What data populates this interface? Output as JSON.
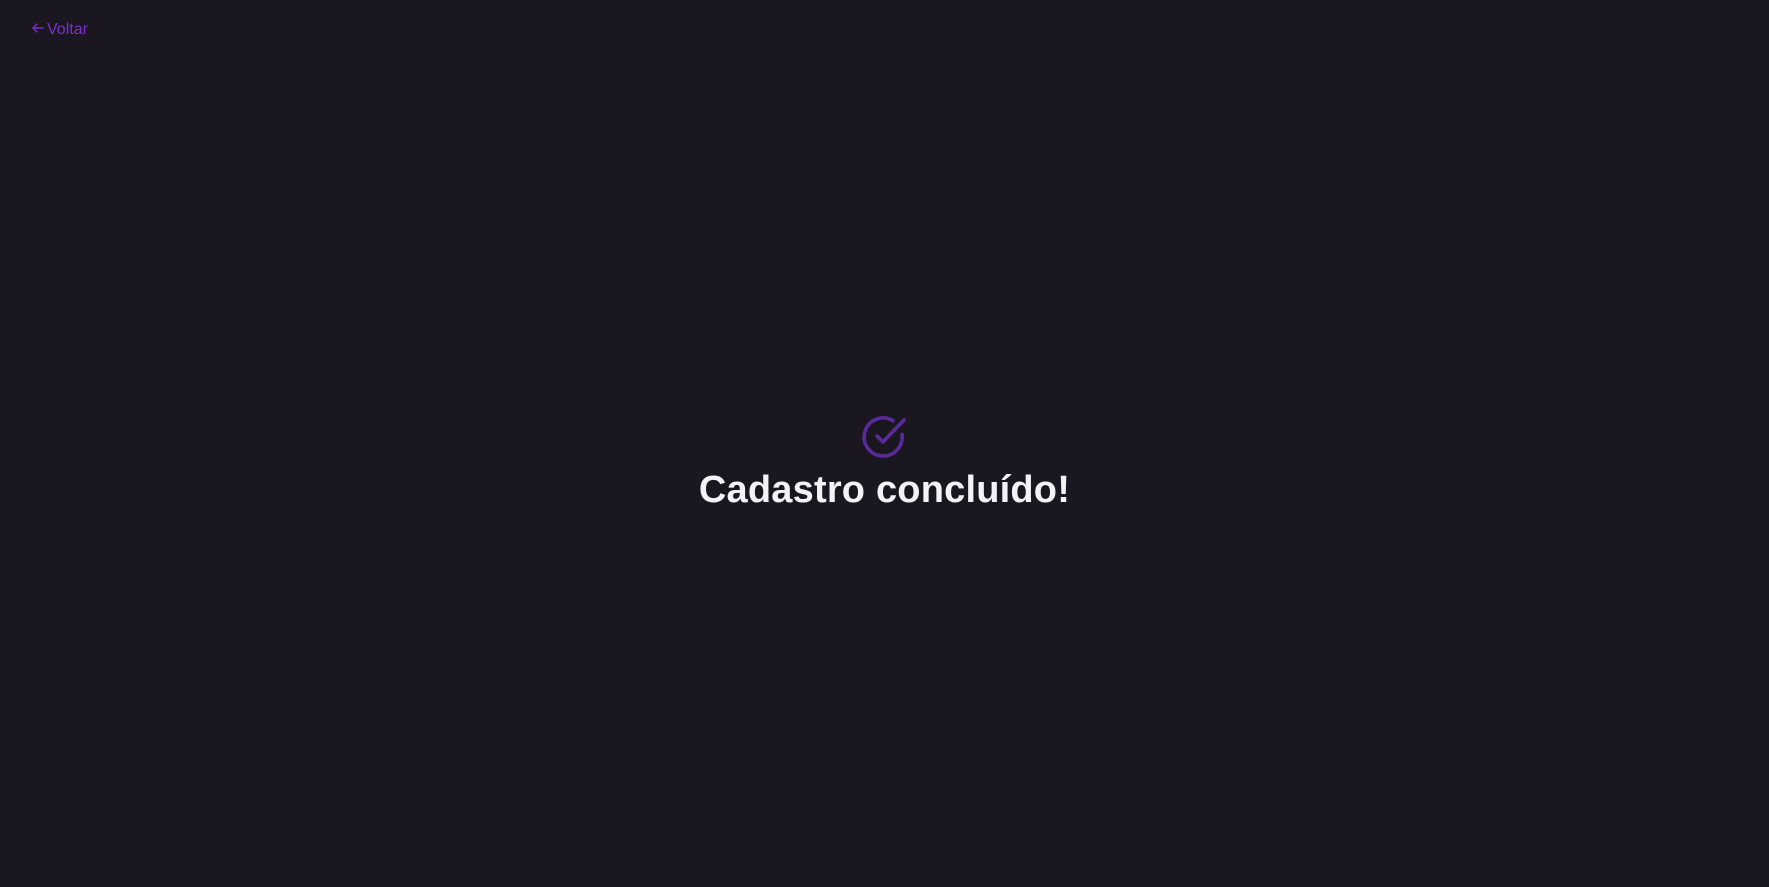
{
  "header": {
    "back_label": "Voltar",
    "back_icon": "arrow-left-icon"
  },
  "main": {
    "success_icon": "check-circle-icon",
    "title": "Cadastro concluído!"
  },
  "colors": {
    "background": "#1a1720",
    "accent": "#7a2fd0",
    "title_text": "#f4f2f7"
  }
}
